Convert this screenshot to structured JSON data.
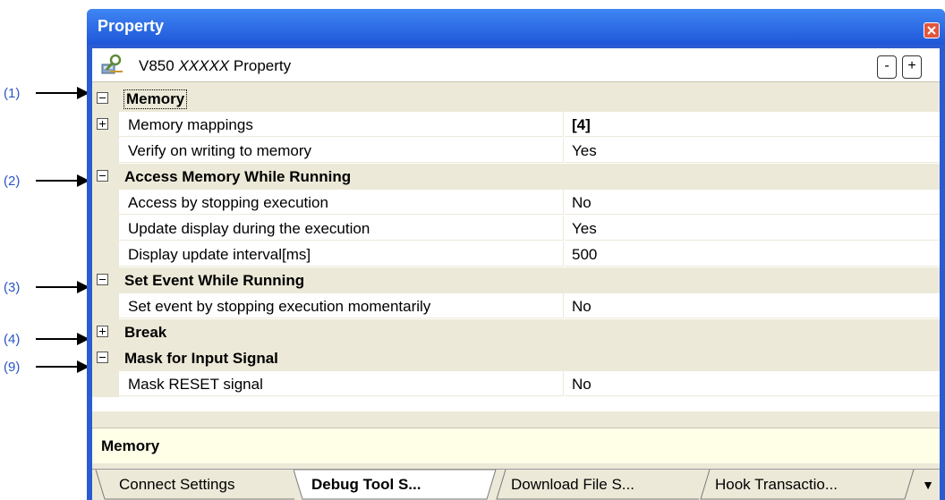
{
  "callouts": [
    "(1)",
    "(2)",
    "(3)",
    "(4)",
    "(9)"
  ],
  "window": {
    "title": "Property"
  },
  "header": {
    "title_prefix": "V850",
    "title_mid": "XXXXX",
    "title_suffix": "Property",
    "collapse_label": "-",
    "expand_label": "+"
  },
  "grid": {
    "memory": {
      "label": "Memory",
      "mappings_name": "Memory mappings",
      "mappings_value": "[4]",
      "verify_name": "Verify on writing to memory",
      "verify_value": "Yes"
    },
    "access": {
      "label": "Access Memory While Running",
      "stop_name": "Access by stopping execution",
      "stop_value": "No",
      "update_name": "Update display during the execution",
      "update_value": "Yes",
      "interval_name": "Display update interval[ms]",
      "interval_value": "500"
    },
    "event": {
      "label": "Set Event While Running",
      "stop_name": "Set event by stopping execution momentarily",
      "stop_value": "No"
    },
    "break": {
      "label": "Break"
    },
    "mask": {
      "label": "Mask for Input Signal",
      "reset_name": "Mask RESET signal",
      "reset_value": "No"
    }
  },
  "description": {
    "text": "Memory"
  },
  "tabs": [
    "Connect Settings",
    "Debug Tool S...",
    "Download File S...",
    "Hook Transactio..."
  ],
  "overflow_label": "▼",
  "colors": {
    "titlebar": "#2a5bd0",
    "panel": "#ece9d8",
    "callout": "#2a55c8"
  }
}
